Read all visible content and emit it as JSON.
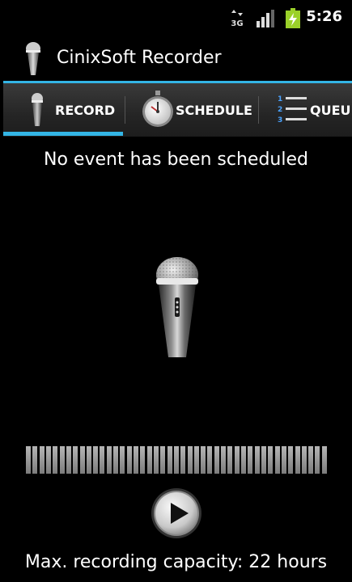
{
  "status_bar": {
    "time": "5:26",
    "network_type": "3G",
    "icons": [
      "3g-data-icon",
      "signal-icon",
      "battery-charging-icon"
    ]
  },
  "app": {
    "title": "CinixSoft Recorder",
    "icon": "microphone-icon"
  },
  "tabs": [
    {
      "label": "RECORD",
      "icon": "microphone-icon",
      "selected": true
    },
    {
      "label": "SCHEDULE",
      "icon": "stopwatch-icon",
      "selected": false
    },
    {
      "label": "QUEU",
      "icon": "numbered-list-icon",
      "selected": false
    }
  ],
  "main": {
    "schedule_status": "No event has been scheduled",
    "capacity_text": "Max. recording capacity: 22 hours",
    "play_icon": "play-icon",
    "level_meter_bars": 45
  },
  "colors": {
    "accent": "#33b5e5",
    "background": "#000000",
    "battery": "#9bd12a"
  }
}
